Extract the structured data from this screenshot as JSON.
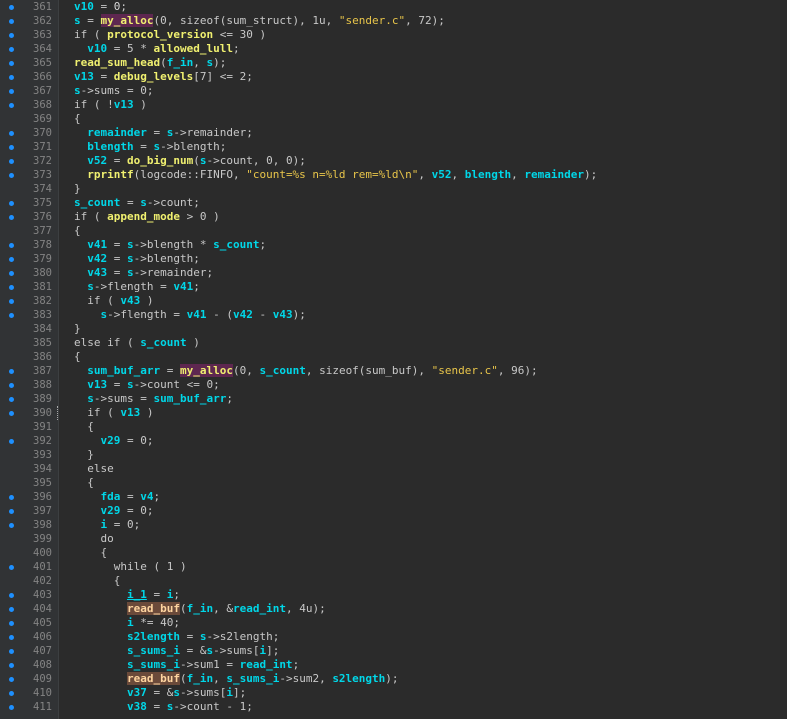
{
  "editor": {
    "lines": [
      {
        "n": "361",
        "bp": true,
        "html": "<span class='var'>v10</span> = <span class='num'>0</span>;"
      },
      {
        "n": "362",
        "bp": true,
        "html": "<span class='var'>s</span> = <span class='hlp'>my_alloc</span>(0, sizeof(sum_struct), 1u, <span class='str'>\"sender.c\"</span>, 72);"
      },
      {
        "n": "363",
        "bp": true,
        "html": "if ( <span class='fn'>protocol_version</span> &lt;= 30 )"
      },
      {
        "n": "364",
        "bp": true,
        "html": "  <span class='var'>v10</span> = 5 * <span class='fn'>allowed_lull</span>;"
      },
      {
        "n": "365",
        "bp": true,
        "html": "<span class='fn'>read_sum_head</span>(<span class='var'>f_in</span>, <span class='var'>s</span>);"
      },
      {
        "n": "366",
        "bp": true,
        "html": "<span class='var'>v13</span> = <span class='fn'>debug_levels</span>[7] &lt;= 2;"
      },
      {
        "n": "367",
        "bp": true,
        "html": "<span class='var'>s</span>-&gt;sums = 0;"
      },
      {
        "n": "368",
        "bp": true,
        "html": "if ( !<span class='var'>v13</span> )"
      },
      {
        "n": "369",
        "bp": false,
        "html": "{"
      },
      {
        "n": "370",
        "bp": true,
        "html": "  <span class='var'>remainder</span> = <span class='var'>s</span>-&gt;remainder;"
      },
      {
        "n": "371",
        "bp": true,
        "html": "  <span class='var'>blength</span> = <span class='var'>s</span>-&gt;blength;"
      },
      {
        "n": "372",
        "bp": true,
        "html": "  <span class='var'>v52</span> = <span class='fn'>do_big_num</span>(<span class='var'>s</span>-&gt;count, 0, 0);"
      },
      {
        "n": "373",
        "bp": true,
        "html": "  <span class='fn'>rprintf</span>(logcode::FINFO, <span class='str'>\"count=%s n=%ld rem=%ld\\n\"</span>, <span class='var'>v52</span>, <span class='var'>blength</span>, <span class='var'>remainder</span>);"
      },
      {
        "n": "374",
        "bp": false,
        "html": "}"
      },
      {
        "n": "375",
        "bp": true,
        "html": "<span class='var'>s_count</span> = <span class='var'>s</span>-&gt;count;"
      },
      {
        "n": "376",
        "bp": true,
        "html": "if ( <span class='fn'>append_mode</span> &gt; 0 )"
      },
      {
        "n": "377",
        "bp": false,
        "html": "{"
      },
      {
        "n": "378",
        "bp": true,
        "html": "  <span class='var'>v41</span> = <span class='var'>s</span>-&gt;blength * <span class='var'>s_count</span>;"
      },
      {
        "n": "379",
        "bp": true,
        "html": "  <span class='var'>v42</span> = <span class='var'>s</span>-&gt;blength;"
      },
      {
        "n": "380",
        "bp": true,
        "html": "  <span class='var'>v43</span> = <span class='var'>s</span>-&gt;remainder;"
      },
      {
        "n": "381",
        "bp": true,
        "html": "  <span class='var'>s</span>-&gt;flength = <span class='var'>v41</span>;"
      },
      {
        "n": "382",
        "bp": true,
        "html": "  if ( <span class='var'>v43</span> )"
      },
      {
        "n": "383",
        "bp": true,
        "html": "    <span class='var'>s</span>-&gt;flength = <span class='var'>v41</span> - (<span class='var'>v42</span> - <span class='var'>v43</span>);"
      },
      {
        "n": "384",
        "bp": false,
        "html": "}"
      },
      {
        "n": "385",
        "bp": false,
        "html": "else if ( <span class='var'>s_count</span> )"
      },
      {
        "n": "386",
        "bp": false,
        "html": "{"
      },
      {
        "n": "387",
        "bp": true,
        "html": "  <span class='var'>sum_buf_arr</span> = <span class='hlp'>my_alloc</span>(0, <span class='var'>s_count</span>, sizeof(sum_buf), <span class='str'>\"sender.c\"</span>, 96);"
      },
      {
        "n": "388",
        "bp": true,
        "html": "  <span class='var'>v13</span> = <span class='var'>s</span>-&gt;count &lt;= 0;"
      },
      {
        "n": "389",
        "bp": true,
        "html": "  <span class='var'>s</span>-&gt;sums = <span class='var'>sum_buf_arr</span>;"
      },
      {
        "n": "390",
        "bp": true,
        "html": "  if ( <span class='var'>v13</span> )",
        "marker": true
      },
      {
        "n": "391",
        "bp": false,
        "html": "  {"
      },
      {
        "n": "392",
        "bp": true,
        "html": "    <span class='var'>v29</span> = 0;"
      },
      {
        "n": "393",
        "bp": false,
        "html": "  }"
      },
      {
        "n": "394",
        "bp": false,
        "html": "  else"
      },
      {
        "n": "395",
        "bp": false,
        "html": "  {"
      },
      {
        "n": "396",
        "bp": true,
        "html": "    <span class='var'>fda</span> = <span class='var'>v4</span>;"
      },
      {
        "n": "397",
        "bp": true,
        "html": "    <span class='var'>v29</span> = 0;"
      },
      {
        "n": "398",
        "bp": true,
        "html": "    <span class='var'>i</span> = 0;"
      },
      {
        "n": "399",
        "bp": false,
        "html": "    do"
      },
      {
        "n": "400",
        "bp": false,
        "html": "    {"
      },
      {
        "n": "401",
        "bp": true,
        "html": "      while ( 1 )"
      },
      {
        "n": "402",
        "bp": false,
        "html": "      {"
      },
      {
        "n": "403",
        "bp": true,
        "html": "        <span class='var under'>i_1</span> = <span class='var'>i</span>;"
      },
      {
        "n": "404",
        "bp": true,
        "html": "        <span class='hlo'>read_buf</span>(<span class='var'>f_in</span>, &amp;<span class='var'>read_int</span>, 4u);"
      },
      {
        "n": "405",
        "bp": true,
        "html": "        <span class='var'>i</span> *= 40;"
      },
      {
        "n": "406",
        "bp": true,
        "html": "        <span class='var'>s2length</span> = <span class='var'>s</span>-&gt;s2length;"
      },
      {
        "n": "407",
        "bp": true,
        "html": "        <span class='var'>s_sums_i</span> = &amp;<span class='var'>s</span>-&gt;sums[<span class='var'>i</span>];"
      },
      {
        "n": "408",
        "bp": true,
        "html": "        <span class='var'>s_sums_i</span>-&gt;sum1 = <span class='var'>read_int</span>;"
      },
      {
        "n": "409",
        "bp": true,
        "html": "        <span class='hlo'>read_buf</span>(<span class='var'>f_in</span>, <span class='var'>s_sums_i</span>-&gt;sum2, <span class='var'>s2length</span>);"
      },
      {
        "n": "410",
        "bp": true,
        "html": "        <span class='var'>v37</span> = &amp;<span class='var'>s</span>-&gt;sums[<span class='var'>i</span>];"
      },
      {
        "n": "411",
        "bp": true,
        "html": "        <span class='var'>v38</span> = <span class='var'>s</span>-&gt;count - 1;"
      }
    ]
  },
  "colors": {
    "background": "#2b2b2b",
    "gutter": "#313335",
    "variable": "#00d7e8",
    "function": "#f0f070",
    "string": "#e8c54a",
    "breakpoint_dot": "#1e90ff"
  }
}
